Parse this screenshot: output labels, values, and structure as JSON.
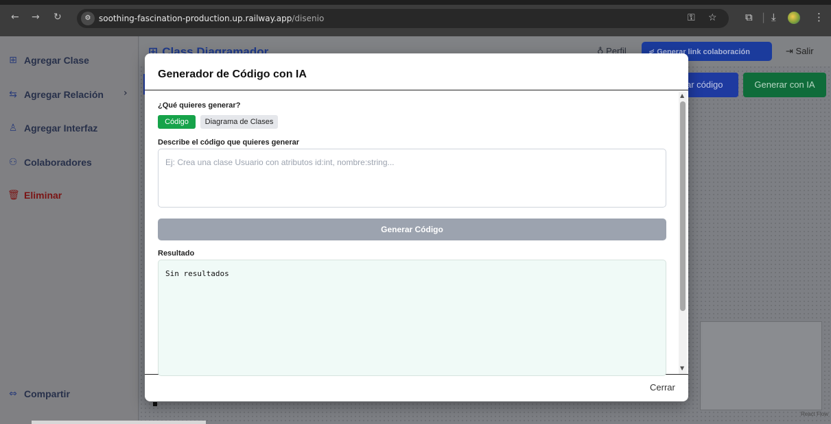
{
  "browser": {
    "url_host": "soothing-fascination-production.up.railway.app",
    "url_path": "/disenio",
    "icons": [
      "back-icon",
      "forward-icon",
      "reload-icon",
      "site-settings-icon",
      "password-key-icon",
      "bookmark-star-icon",
      "extensions-icon",
      "download-icon",
      "profile-avatar",
      "menu-kebab-icon"
    ]
  },
  "sidebar": {
    "items": [
      {
        "label": "Agregar Clase",
        "icon": "⊞"
      },
      {
        "label": "Agregar Relación",
        "icon": "⇆"
      },
      {
        "label": "Agregar Interfaz",
        "icon": "♙"
      },
      {
        "label": "Colaboradores",
        "icon": "⚇"
      },
      {
        "label": "Eliminar",
        "icon": "🗑"
      }
    ],
    "share_label": "Compartir",
    "share_icon": "⇔"
  },
  "header": {
    "brand": "Class Diagramador",
    "brand_icon": "⊞",
    "perfil": "Perfil",
    "link_button": "Generar link colaboración",
    "salir": "Salir"
  },
  "toolbar": {
    "gen_code_partial": "ar código",
    "gen_ia": "Generar con IA"
  },
  "canvas": {
    "react_flow": "React Flow"
  },
  "modal": {
    "title": "Generador de Código con IA",
    "question": "¿Qué quieres generar?",
    "toggle_active": "Código",
    "toggle_inactive": "Diagrama de Clases",
    "describe_label": "Describe el código que quieres generar",
    "placeholder": "Ej: Crea una clase Usuario con atributos id:int, nombre:string...",
    "generate_button": "Generar Código",
    "result_label": "Resultado",
    "result_text": "Sin resultados",
    "close": "Cerrar"
  },
  "colors": {
    "primary_blue": "#1e40af",
    "success_green": "#16a34a",
    "disabled_gray": "#9ca3af",
    "result_bg": "#f0faf7"
  }
}
